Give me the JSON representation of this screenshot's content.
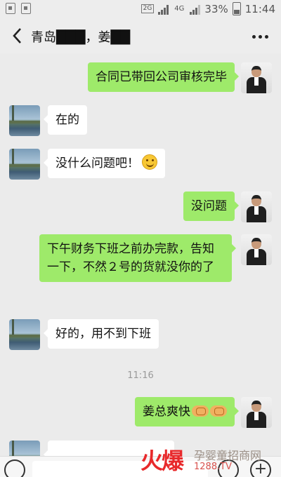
{
  "status_bar": {
    "network_label": "2G",
    "network_label_2": "4G",
    "battery": "33%",
    "time": "11:44"
  },
  "header": {
    "title": "青岛███，姜██"
  },
  "messages": [
    {
      "side": "right",
      "text": "合同已带回公司审核完毕"
    },
    {
      "side": "left",
      "text": "在的"
    },
    {
      "side": "left",
      "text": "没什么问题吧！",
      "emoji": "smile-icon"
    },
    {
      "side": "right",
      "text": "没问题"
    },
    {
      "side": "right",
      "text": "下午财务下班之前办完款，告知一下，不然２号的货就没你的了"
    },
    {
      "side": "left",
      "text": "好的，用不到下班"
    },
    {
      "side": "right",
      "text": "姜总爽快",
      "emoji": "handshake-icon"
    },
    {
      "side": "left",
      "text": ""
    }
  ],
  "timestamp": "11:16",
  "watermark": {
    "brand": "火爆",
    "tagline": "孕婴童招商网",
    "url": "1288.TV"
  },
  "colors": {
    "sent_bubble": "#9eea6a",
    "received_bubble": "#ffffff",
    "background": "#ebebeb",
    "watermark_red": "#e8292b"
  }
}
